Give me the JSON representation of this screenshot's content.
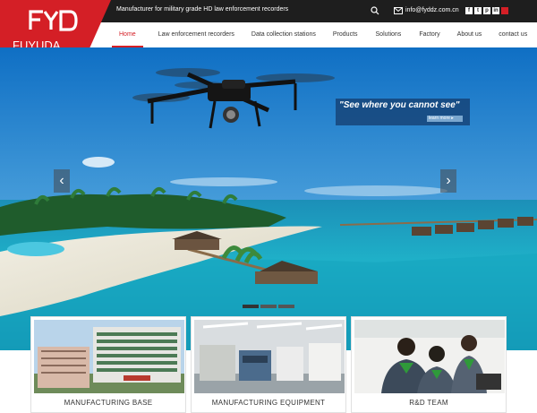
{
  "header": {
    "brand": "FUYUDA",
    "logo_mark": "FYD",
    "tagline": "Manufacturer for military grade HD law enforcement recorders",
    "email": "info@fyddz.com.cn",
    "social": [
      "f",
      "t",
      "p",
      "in"
    ]
  },
  "nav": {
    "items": [
      {
        "label": "Home",
        "active": true
      },
      {
        "label": "Law enforcement recorders"
      },
      {
        "label": "Data collection stations"
      },
      {
        "label": "Products"
      },
      {
        "label": "Solutions"
      },
      {
        "label": "Factory"
      },
      {
        "label": "About us"
      },
      {
        "label": "contact us"
      }
    ]
  },
  "hero": {
    "slogan": "\"See where you cannot see\"",
    "learn_more": "learn more",
    "prev_icon": "chevron-left-icon",
    "next_icon": "chevron-right-icon",
    "slides": 3,
    "active_slide": 1
  },
  "cards": [
    {
      "caption": "MANUFACTURING BASE"
    },
    {
      "caption": "MANUFACTURING EQUIPMENT"
    },
    {
      "caption": "R&D TEAM"
    }
  ],
  "colors": {
    "accent": "#d41f26",
    "topbar": "#1e1e1e",
    "sea": "#19a6c7"
  }
}
